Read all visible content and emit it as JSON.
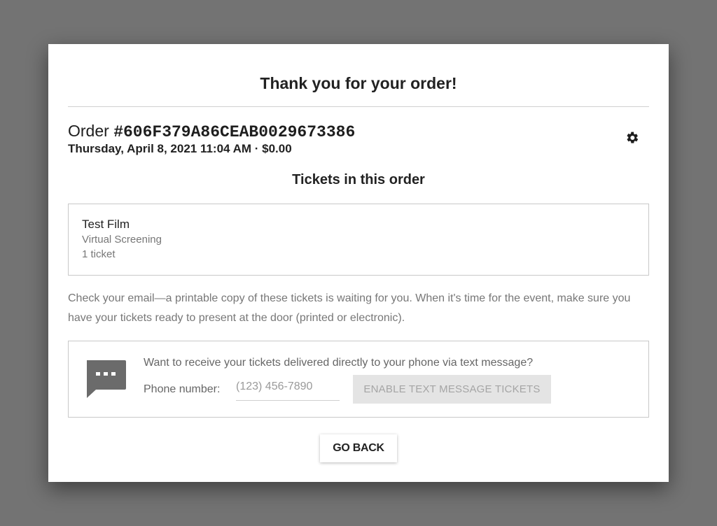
{
  "modal": {
    "title": "Thank you for your order!"
  },
  "order": {
    "prefix": "Order ",
    "number": "#606F379A86CEAB0029673386",
    "meta": "Thursday, April 8, 2021 11:04 AM · $0.00",
    "settings_icon": "gear-icon"
  },
  "tickets": {
    "heading": "Tickets in this order",
    "items": [
      {
        "title": "Test Film",
        "type": "Virtual Screening",
        "count": "1 ticket"
      }
    ]
  },
  "note": "Check your email—a printable copy of these tickets is waiting for you. When it's time for the event, make sure you have your tickets ready to present at the door (printed or electronic).",
  "sms": {
    "icon": "chat-bubble-icon",
    "question": "Want to receive your tickets delivered directly to your phone via text message?",
    "phone_label": "Phone number:",
    "phone_value": "",
    "phone_placeholder": "(123) 456-7890",
    "enable_label": "ENABLE TEXT MESSAGE TICKETS"
  },
  "actions": {
    "go_back_label": "GO BACK"
  },
  "colors": {
    "backdrop": "#737373",
    "modal_bg": "#ffffff",
    "muted_text": "#777777",
    "disabled_button_bg": "#e4e4e4",
    "disabled_button_text": "#a5a5a5",
    "icon_gray": "#6b6b6b"
  }
}
